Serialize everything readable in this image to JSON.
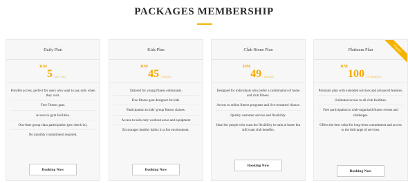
{
  "section": {
    "title": "PACKAGES MEMBERSHIP",
    "accent_color": "#f5b301"
  },
  "plans": [
    {
      "name": "Daily Plan",
      "currency": "RM",
      "price": "5",
      "period": "/ per day",
      "features": [
        "Flexible access, perfect for users who want to pay only when they visit.",
        "Free Fitness gear.",
        "Access to gym facilities.",
        "One-time group class participation (per check-in).",
        "No monthly commitment required."
      ],
      "button": "Booking Now"
    },
    {
      "name": "Kids Plan",
      "currency": "RM",
      "price": "45",
      "period": "/ month",
      "features": [
        "Tailored for young fitness enthusiasts.",
        "Free fitness gear designed for kids.",
        "Participation in kids' group fitness classes.",
        "Access to kids-only workout areas and equipment",
        "Encourages healthy habits in a fun environment."
      ],
      "button": "Booking Now"
    },
    {
      "name": "Club Home Plan",
      "currency": "RM",
      "price": "49",
      "period": "/ month",
      "features": [
        "Designed for individuals who prefer a combination of home and club fitness.",
        "Access to online fitness programs and live-streamed classes.",
        "Quality customer service and flexibility.",
        "Ideal for people who want the flexibility to train at home but still want club benefits."
      ],
      "button": "Booking Now"
    },
    {
      "name": "Platinum Plan",
      "currency": "RM",
      "price": "100",
      "period": "/ 3 months",
      "ribbon": "Popular",
      "features": [
        "Premium plan with extended services and advanced features.",
        "Unlimited access to all club facilities.",
        "Free participation in club-organized fitness events and challenges.",
        "Offers the best value for long-term commitment and access to the full range of services."
      ],
      "button": "Booking Now"
    }
  ]
}
